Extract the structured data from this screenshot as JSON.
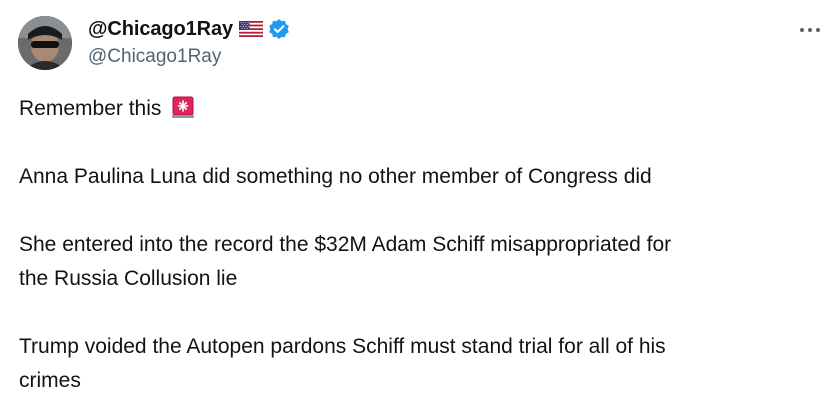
{
  "author": {
    "display_name": "@Chicago1Ray",
    "handle": "@Chicago1Ray",
    "flag_icon": "us-flag-icon",
    "verified_icon": "verified-badge-icon",
    "verified_color": "#1d9bf0"
  },
  "menu": {
    "more_icon": "more-options-icon"
  },
  "tweet": {
    "line1": "Remember this",
    "line1_emoji": "police-siren-icon",
    "para2": "Anna Paulina Luna did something no other member of Congress did",
    "para3_line1": "She entered into the record the $32M Adam Schiff misappropriated for",
    "para3_line2": "the Russia Collusion lie",
    "para4_line1": "Trump voided the Autopen pardons Schiff must stand trial for all of his",
    "para4_line2": "crimes"
  },
  "colors": {
    "text": "#0f1419",
    "secondary": "#536471",
    "accent": "#1d9bf0"
  }
}
